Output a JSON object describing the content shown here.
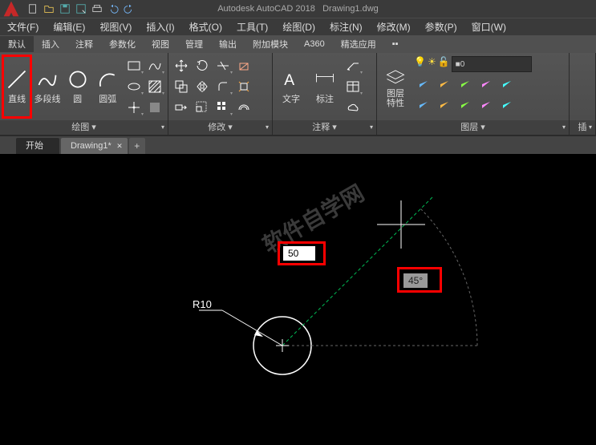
{
  "app": {
    "title": "Autodesk AutoCAD 2018",
    "doc": "Drawing1.dwg"
  },
  "menu": {
    "file": "文件(F)",
    "edit": "编辑(E)",
    "view": "视图(V)",
    "insert": "插入(I)",
    "format": "格式(O)",
    "tools": "工具(T)",
    "draw": "绘图(D)",
    "dimension": "标注(N)",
    "modify": "修改(M)",
    "params": "参数(P)",
    "window": "窗口(W)"
  },
  "tabs": {
    "default": "默认",
    "insert": "插入",
    "annotate": "注释",
    "parametric": "参数化",
    "view": "视图",
    "manage": "管理",
    "output": "输出",
    "addins": "附加模块",
    "a360": "A360",
    "express": "精选应用"
  },
  "panels": {
    "draw": "绘图 ▾",
    "modify": "修改 ▾",
    "annot": "注释 ▾",
    "layers": "图层 ▾",
    "ins": "插"
  },
  "draw": {
    "line": "直线",
    "polyline": "多段线",
    "circle": "圆",
    "arc": "圆弧"
  },
  "annot": {
    "text": "文字",
    "dim": "标注"
  },
  "layers": {
    "props": "图层\n特性",
    "current": "0"
  },
  "doctabs": {
    "start": "开始",
    "d1": "Drawing1*"
  },
  "drawing": {
    "radius": "R10",
    "length": "50",
    "angle": "45°"
  },
  "watermark": "软件自学网"
}
